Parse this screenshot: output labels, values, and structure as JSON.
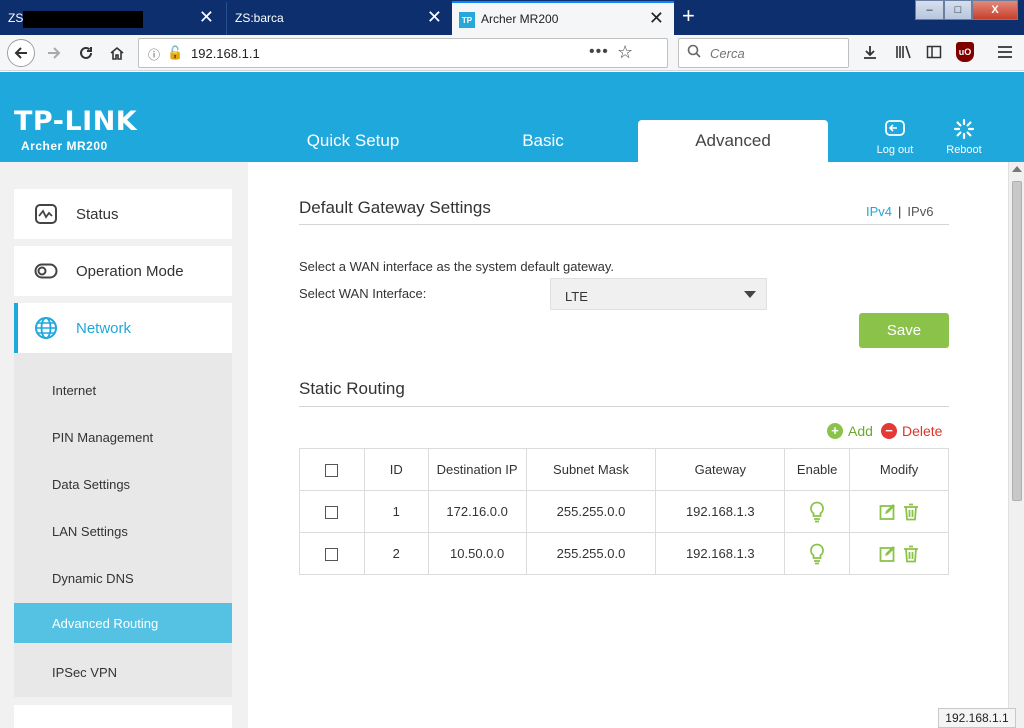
{
  "browser": {
    "tabs": [
      {
        "title": "ZS",
        "close": "✕"
      },
      {
        "title": "ZS:barca",
        "close": "✕"
      },
      {
        "title": "Archer MR200",
        "favicon": "TP",
        "close": "✕"
      }
    ],
    "new_tab": "+",
    "url": "192.168.1.1",
    "page_actions": "•••",
    "search_placeholder": "Cerca",
    "window_controls": {
      "minimize": "–",
      "maximize": "□",
      "close": "X"
    }
  },
  "router": {
    "logo": "TP-LINK",
    "model": "Archer MR200",
    "main_tabs": [
      {
        "label": "Quick Setup"
      },
      {
        "label": "Basic"
      },
      {
        "label": "Advanced"
      }
    ],
    "header_buttons": {
      "logout": "Log out",
      "reboot": "Reboot"
    },
    "accent_color": "#1fa8dc"
  },
  "sidebar": {
    "main_items": [
      {
        "label": "Status",
        "icon": "status-icon"
      },
      {
        "label": "Operation Mode",
        "icon": "toggle-icon"
      },
      {
        "label": "Network",
        "icon": "globe-icon"
      }
    ],
    "sub_items": [
      {
        "label": "Internet"
      },
      {
        "label": "PIN Management"
      },
      {
        "label": "Data Settings"
      },
      {
        "label": "LAN Settings"
      },
      {
        "label": "Dynamic DNS"
      },
      {
        "label": "Advanced Routing"
      },
      {
        "label": "IPSec VPN"
      }
    ],
    "active_sub_item": "Advanced Routing"
  },
  "gateway": {
    "title": "Default Gateway Settings",
    "ipv4": "IPv4",
    "ipv6": "IPv6",
    "separator": "|",
    "description": "Select a WAN interface as the system default gateway.",
    "wan_label": "Select WAN Interface:",
    "wan_value": "LTE",
    "save_label": "Save"
  },
  "static_routing": {
    "title": "Static Routing",
    "add_label": "Add",
    "delete_label": "Delete",
    "columns": [
      "ID",
      "Destination IP",
      "Subnet Mask",
      "Gateway",
      "Enable",
      "Modify"
    ],
    "rows": [
      {
        "id": "1",
        "destination": "172.16.0.0",
        "mask": "255.255.0.0",
        "gateway": "192.168.1.3"
      },
      {
        "id": "2",
        "destination": "10.50.0.0",
        "mask": "255.255.0.0",
        "gateway": "192.168.1.3"
      }
    ]
  },
  "status_bar": "192.168.1.1"
}
